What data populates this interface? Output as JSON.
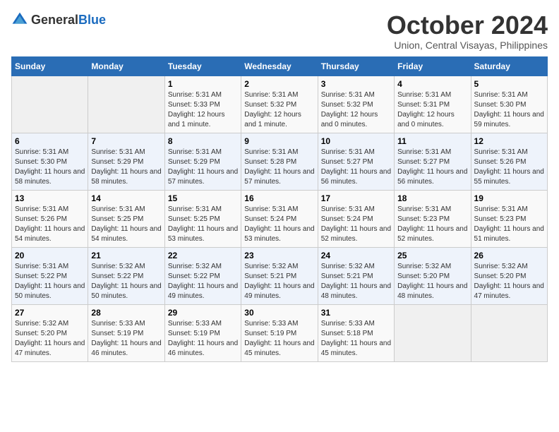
{
  "logo": {
    "general": "General",
    "blue": "Blue"
  },
  "title": "October 2024",
  "subtitle": "Union, Central Visayas, Philippines",
  "headers": [
    "Sunday",
    "Monday",
    "Tuesday",
    "Wednesday",
    "Thursday",
    "Friday",
    "Saturday"
  ],
  "weeks": [
    [
      {
        "day": "",
        "sunrise": "",
        "sunset": "",
        "daylight": ""
      },
      {
        "day": "",
        "sunrise": "",
        "sunset": "",
        "daylight": ""
      },
      {
        "day": "1",
        "sunrise": "Sunrise: 5:31 AM",
        "sunset": "Sunset: 5:33 PM",
        "daylight": "Daylight: 12 hours and 1 minute."
      },
      {
        "day": "2",
        "sunrise": "Sunrise: 5:31 AM",
        "sunset": "Sunset: 5:32 PM",
        "daylight": "Daylight: 12 hours and 1 minute."
      },
      {
        "day": "3",
        "sunrise": "Sunrise: 5:31 AM",
        "sunset": "Sunset: 5:32 PM",
        "daylight": "Daylight: 12 hours and 0 minutes."
      },
      {
        "day": "4",
        "sunrise": "Sunrise: 5:31 AM",
        "sunset": "Sunset: 5:31 PM",
        "daylight": "Daylight: 12 hours and 0 minutes."
      },
      {
        "day": "5",
        "sunrise": "Sunrise: 5:31 AM",
        "sunset": "Sunset: 5:30 PM",
        "daylight": "Daylight: 11 hours and 59 minutes."
      }
    ],
    [
      {
        "day": "6",
        "sunrise": "Sunrise: 5:31 AM",
        "sunset": "Sunset: 5:30 PM",
        "daylight": "Daylight: 11 hours and 58 minutes."
      },
      {
        "day": "7",
        "sunrise": "Sunrise: 5:31 AM",
        "sunset": "Sunset: 5:29 PM",
        "daylight": "Daylight: 11 hours and 58 minutes."
      },
      {
        "day": "8",
        "sunrise": "Sunrise: 5:31 AM",
        "sunset": "Sunset: 5:29 PM",
        "daylight": "Daylight: 11 hours and 57 minutes."
      },
      {
        "day": "9",
        "sunrise": "Sunrise: 5:31 AM",
        "sunset": "Sunset: 5:28 PM",
        "daylight": "Daylight: 11 hours and 57 minutes."
      },
      {
        "day": "10",
        "sunrise": "Sunrise: 5:31 AM",
        "sunset": "Sunset: 5:27 PM",
        "daylight": "Daylight: 11 hours and 56 minutes."
      },
      {
        "day": "11",
        "sunrise": "Sunrise: 5:31 AM",
        "sunset": "Sunset: 5:27 PM",
        "daylight": "Daylight: 11 hours and 56 minutes."
      },
      {
        "day": "12",
        "sunrise": "Sunrise: 5:31 AM",
        "sunset": "Sunset: 5:26 PM",
        "daylight": "Daylight: 11 hours and 55 minutes."
      }
    ],
    [
      {
        "day": "13",
        "sunrise": "Sunrise: 5:31 AM",
        "sunset": "Sunset: 5:26 PM",
        "daylight": "Daylight: 11 hours and 54 minutes."
      },
      {
        "day": "14",
        "sunrise": "Sunrise: 5:31 AM",
        "sunset": "Sunset: 5:25 PM",
        "daylight": "Daylight: 11 hours and 54 minutes."
      },
      {
        "day": "15",
        "sunrise": "Sunrise: 5:31 AM",
        "sunset": "Sunset: 5:25 PM",
        "daylight": "Daylight: 11 hours and 53 minutes."
      },
      {
        "day": "16",
        "sunrise": "Sunrise: 5:31 AM",
        "sunset": "Sunset: 5:24 PM",
        "daylight": "Daylight: 11 hours and 53 minutes."
      },
      {
        "day": "17",
        "sunrise": "Sunrise: 5:31 AM",
        "sunset": "Sunset: 5:24 PM",
        "daylight": "Daylight: 11 hours and 52 minutes."
      },
      {
        "day": "18",
        "sunrise": "Sunrise: 5:31 AM",
        "sunset": "Sunset: 5:23 PM",
        "daylight": "Daylight: 11 hours and 52 minutes."
      },
      {
        "day": "19",
        "sunrise": "Sunrise: 5:31 AM",
        "sunset": "Sunset: 5:23 PM",
        "daylight": "Daylight: 11 hours and 51 minutes."
      }
    ],
    [
      {
        "day": "20",
        "sunrise": "Sunrise: 5:31 AM",
        "sunset": "Sunset: 5:22 PM",
        "daylight": "Daylight: 11 hours and 50 minutes."
      },
      {
        "day": "21",
        "sunrise": "Sunrise: 5:32 AM",
        "sunset": "Sunset: 5:22 PM",
        "daylight": "Daylight: 11 hours and 50 minutes."
      },
      {
        "day": "22",
        "sunrise": "Sunrise: 5:32 AM",
        "sunset": "Sunset: 5:22 PM",
        "daylight": "Daylight: 11 hours and 49 minutes."
      },
      {
        "day": "23",
        "sunrise": "Sunrise: 5:32 AM",
        "sunset": "Sunset: 5:21 PM",
        "daylight": "Daylight: 11 hours and 49 minutes."
      },
      {
        "day": "24",
        "sunrise": "Sunrise: 5:32 AM",
        "sunset": "Sunset: 5:21 PM",
        "daylight": "Daylight: 11 hours and 48 minutes."
      },
      {
        "day": "25",
        "sunrise": "Sunrise: 5:32 AM",
        "sunset": "Sunset: 5:20 PM",
        "daylight": "Daylight: 11 hours and 48 minutes."
      },
      {
        "day": "26",
        "sunrise": "Sunrise: 5:32 AM",
        "sunset": "Sunset: 5:20 PM",
        "daylight": "Daylight: 11 hours and 47 minutes."
      }
    ],
    [
      {
        "day": "27",
        "sunrise": "Sunrise: 5:32 AM",
        "sunset": "Sunset: 5:20 PM",
        "daylight": "Daylight: 11 hours and 47 minutes."
      },
      {
        "day": "28",
        "sunrise": "Sunrise: 5:33 AM",
        "sunset": "Sunset: 5:19 PM",
        "daylight": "Daylight: 11 hours and 46 minutes."
      },
      {
        "day": "29",
        "sunrise": "Sunrise: 5:33 AM",
        "sunset": "Sunset: 5:19 PM",
        "daylight": "Daylight: 11 hours and 46 minutes."
      },
      {
        "day": "30",
        "sunrise": "Sunrise: 5:33 AM",
        "sunset": "Sunset: 5:19 PM",
        "daylight": "Daylight: 11 hours and 45 minutes."
      },
      {
        "day": "31",
        "sunrise": "Sunrise: 5:33 AM",
        "sunset": "Sunset: 5:18 PM",
        "daylight": "Daylight: 11 hours and 45 minutes."
      },
      {
        "day": "",
        "sunrise": "",
        "sunset": "",
        "daylight": ""
      },
      {
        "day": "",
        "sunrise": "",
        "sunset": "",
        "daylight": ""
      }
    ]
  ]
}
